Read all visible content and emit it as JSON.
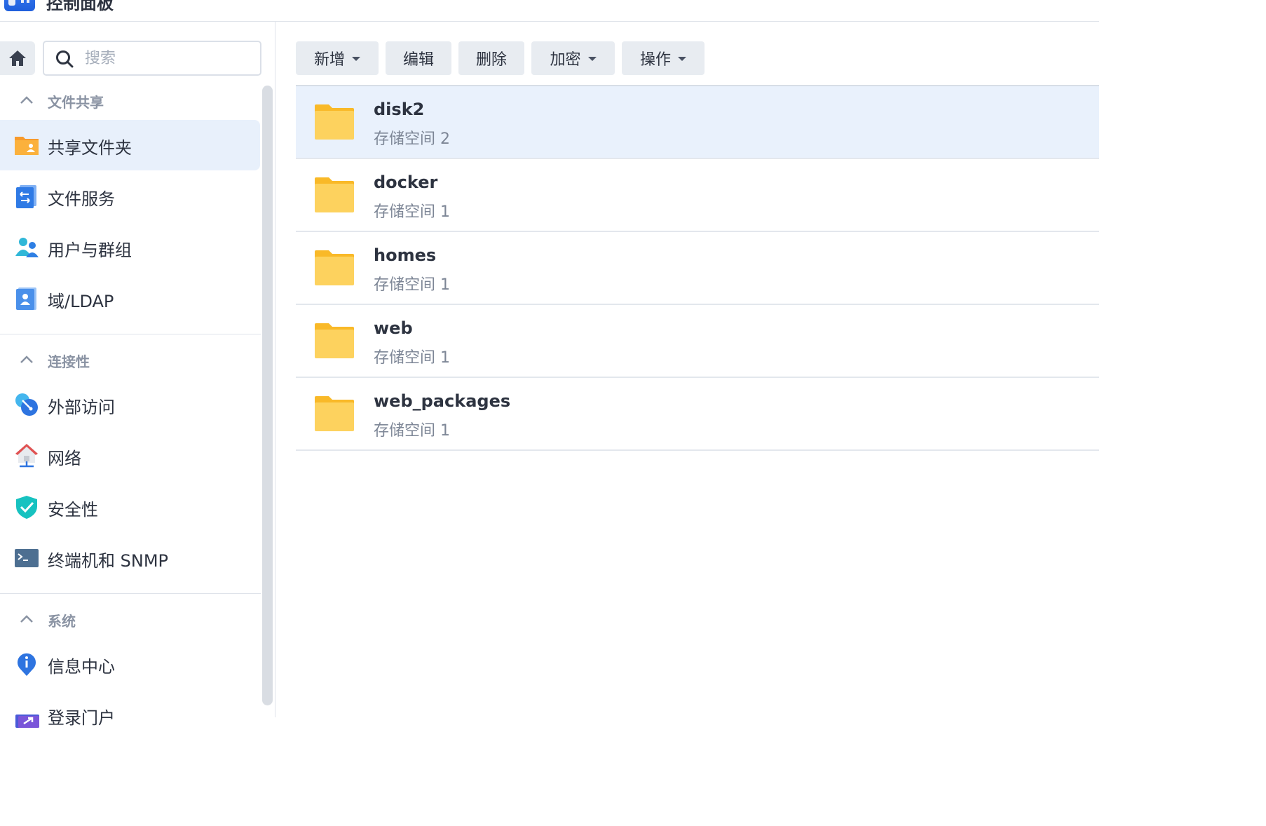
{
  "app": {
    "title": "控制面板"
  },
  "search": {
    "placeholder": "搜索"
  },
  "sidebar": {
    "groups": [
      {
        "label": "文件共享",
        "items": [
          {
            "label": "共享文件夹",
            "icon": "shared-folder-icon",
            "selected": true
          },
          {
            "label": "文件服务",
            "icon": "file-services-icon"
          },
          {
            "label": "用户与群组",
            "icon": "users-groups-icon"
          },
          {
            "label": "域/LDAP",
            "icon": "domain-ldap-icon"
          }
        ]
      },
      {
        "label": "连接性",
        "items": [
          {
            "label": "外部访问",
            "icon": "external-access-icon"
          },
          {
            "label": "网络",
            "icon": "network-icon"
          },
          {
            "label": "安全性",
            "icon": "security-shield-icon"
          },
          {
            "label": "终端机和 SNMP",
            "icon": "terminal-icon"
          }
        ]
      },
      {
        "label": "系统",
        "items": [
          {
            "label": "信息中心",
            "icon": "info-center-icon"
          },
          {
            "label": "登录门户",
            "icon": "login-portal-icon"
          }
        ]
      }
    ]
  },
  "toolbar": {
    "create": "新增",
    "edit": "编辑",
    "delete": "删除",
    "encrypt": "加密",
    "action": "操作"
  },
  "folders": [
    {
      "name": "disk2",
      "volume": "存储空间 2",
      "selected": true
    },
    {
      "name": "docker",
      "volume": "存储空间 1"
    },
    {
      "name": "homes",
      "volume": "存储空间 1"
    },
    {
      "name": "web",
      "volume": "存储空间 1"
    },
    {
      "name": "web_packages",
      "volume": "存储空间 1"
    }
  ],
  "colors": {
    "accent": "#1f6fe0",
    "folder": "#fcc63f",
    "selection": "#e9f1fc",
    "button": "#e8ecf1"
  }
}
